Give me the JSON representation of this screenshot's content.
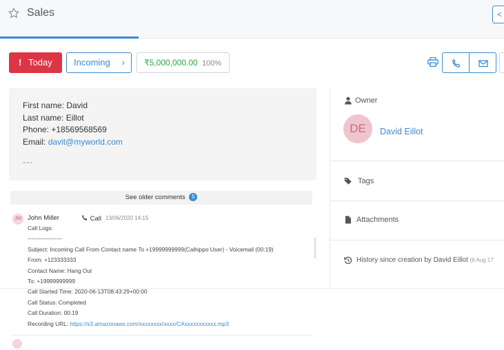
{
  "header": {
    "title": "Sales",
    "back_label": "<"
  },
  "actions": {
    "today_label": "Today",
    "today_icon": "!",
    "stage_label": "Incoming",
    "stage_chevron": "›",
    "amount": "₹5,000,000.00",
    "probability": "100%"
  },
  "description": {
    "lines": [
      "First name: David",
      "Last name: Eillot",
      "Phone: +18569568569"
    ],
    "email_label": "Email:",
    "email": "davit@myworld.com",
    "ellipsis": "---"
  },
  "comments": {
    "older_label": "See older comments",
    "older_count": "5",
    "items": [
      {
        "initials": "JM",
        "author": "John Miller",
        "type": "Call",
        "date": "13/06/2020 14:15",
        "lines": [
          "Call Logs:",
          "------------------",
          "Subject: Incoming Call From Contact name To +19999999999(Calhippo User) - Voicemail (00:19)",
          "From: +123333333",
          "Contact Name: Hang Out",
          "To: +19999999999",
          "Call Started Time: 2020-06-13T08:43:29+00:00",
          "Call Status: Completed",
          "Call Duration: 00:19"
        ],
        "recording_label": "Recording URL:",
        "recording_url": "https://s3.amazonaws.com/xxxxxxxx/xxxx/CAxxxxxxxxxxx.mp3"
      }
    ]
  },
  "sidebar": {
    "owner_label": "Owner",
    "owner_initials": "DE",
    "owner_name": "David Eillot",
    "tags_label": "Tags",
    "attachments_label": "Attachments",
    "history_label": "History since creation by David Eillot",
    "history_date": "(6 Aug 17"
  },
  "colors": {
    "accent": "#3a8ad0",
    "danger": "#dc3545",
    "success": "#28a745",
    "avatar_bg": "#f0c4cd"
  }
}
